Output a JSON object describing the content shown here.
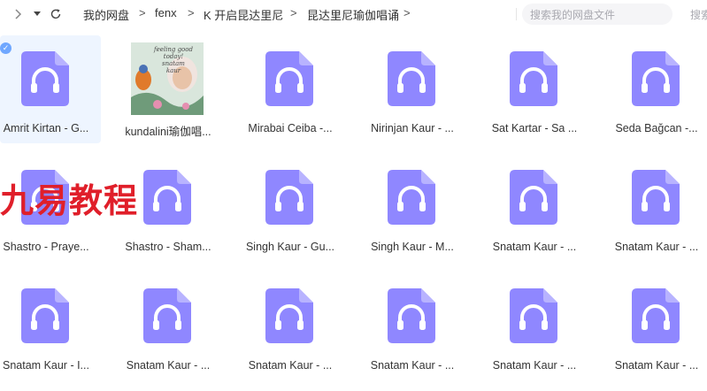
{
  "toolbar": {
    "back_icon": "chevron-right-icon",
    "dropdown_icon": "caret-down-icon",
    "refresh_icon": "refresh-icon",
    "breadcrumbs": [
      "我的网盘",
      "fenx",
      "K 开启昆达里尼",
      "昆达里尼瑜伽唱诵"
    ],
    "separator": ">",
    "search_placeholder": "搜索我的网盘文件",
    "search_button": "搜索"
  },
  "watermark": "九易教程",
  "files": [
    {
      "label": "Amrit Kirtan - G...",
      "type": "audio",
      "selected": true
    },
    {
      "label": "kundalini瑜伽唱...",
      "type": "image"
    },
    {
      "label": "Mirabai Ceiba -...",
      "type": "audio"
    },
    {
      "label": "Nirinjan Kaur - ...",
      "type": "audio"
    },
    {
      "label": "Sat Kartar - Sa ...",
      "type": "audio"
    },
    {
      "label": "Seda Bağcan -...",
      "type": "audio"
    },
    {
      "label": "Shastro - Praye...",
      "type": "audio"
    },
    {
      "label": "Shastro - Sham...",
      "type": "audio"
    },
    {
      "label": "Singh Kaur - Gu...",
      "type": "audio"
    },
    {
      "label": "Singh Kaur - M...",
      "type": "audio"
    },
    {
      "label": "Snatam Kaur - ...",
      "type": "audio"
    },
    {
      "label": "Snatam Kaur - ...",
      "type": "audio"
    },
    {
      "label": "Snatam Kaur - I...",
      "type": "audio"
    },
    {
      "label": "Snatam Kaur - ...",
      "type": "audio"
    },
    {
      "label": "Snatam Kaur - ...",
      "type": "audio"
    },
    {
      "label": "Snatam Kaur - ...",
      "type": "audio"
    },
    {
      "label": "Snatam Kaur - ...",
      "type": "audio"
    },
    {
      "label": "Snatam Kaur - ...",
      "type": "audio"
    }
  ],
  "thumbnail_text": {
    "line1": "feeling good",
    "line2": "today!",
    "line3": "snatam",
    "line4": "kaur"
  },
  "colors": {
    "icon_fill": "#8f87ff",
    "icon_fold": "#b8b3ff",
    "selected_bg": "#eef5ff",
    "watermark": "#e01f2a"
  }
}
